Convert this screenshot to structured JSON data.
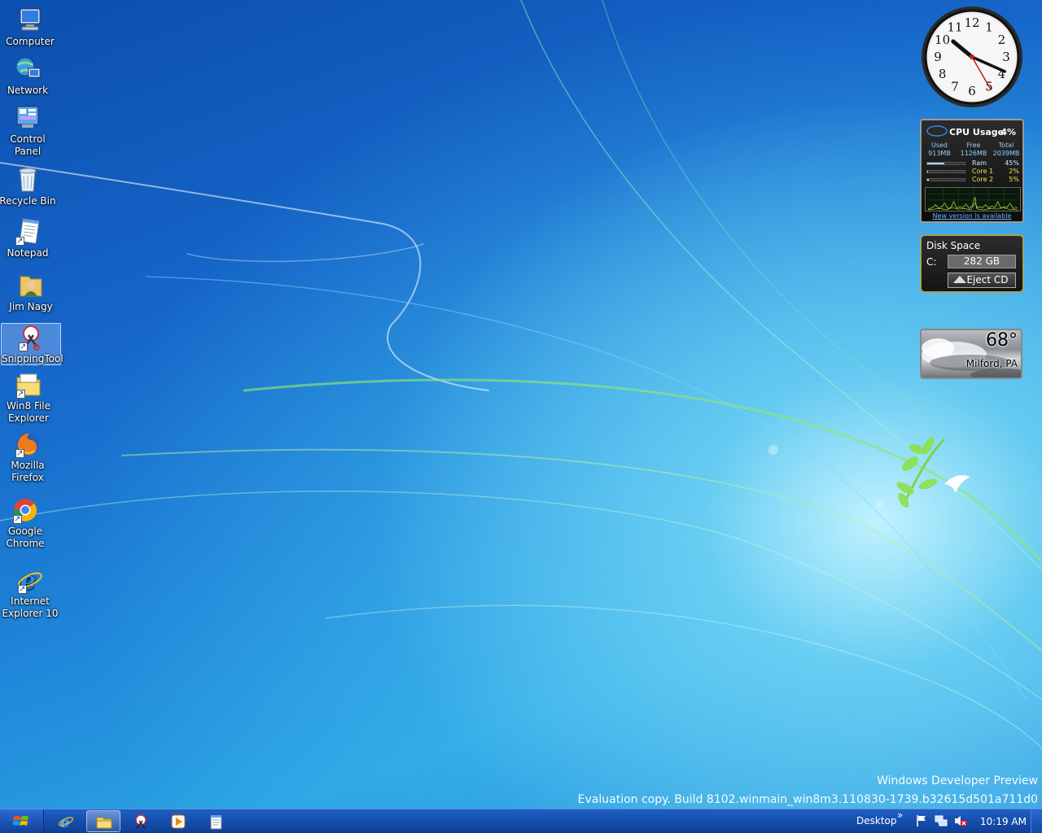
{
  "desktop_icons": [
    {
      "label": "Computer"
    },
    {
      "label": "Network"
    },
    {
      "label": "Control Panel"
    },
    {
      "label": "Recycle Bin"
    },
    {
      "label": "Notepad"
    },
    {
      "label": "Jim Nagy"
    },
    {
      "label": "SnippingTool"
    },
    {
      "label": "Win8 File Explorer"
    },
    {
      "label": "Mozilla Firefox"
    },
    {
      "label": "Google Chrome"
    },
    {
      "label": "Internet Explorer 10"
    }
  ],
  "clock_gadget": {
    "numerals": [
      "12",
      "1",
      "2",
      "3",
      "4",
      "5",
      "6",
      "7",
      "8",
      "9",
      "10",
      "11"
    ],
    "hour": 10,
    "minute": 19,
    "second": 25
  },
  "cpu_gadget": {
    "title": "CPU Usage",
    "percent": "4%",
    "used_label": "Used",
    "used_value": "913MB",
    "free_label": "Free",
    "free_value": "1126MB",
    "total_label": "Total",
    "total_value": "2039MB",
    "rows": [
      {
        "label": "Ram",
        "value": "45%",
        "level": 0.45
      },
      {
        "label": "Core 1",
        "value": "2%",
        "level": 0.02
      },
      {
        "label": "Core 2",
        "value": "5%",
        "level": 0.05
      }
    ],
    "update_link": "New version is available"
  },
  "disk_gadget": {
    "title": "Disk Space",
    "drive": "C:",
    "free": "282 GB",
    "eject_label": "Eject CD"
  },
  "weather_gadget": {
    "temperature": "68°",
    "location": "Milford, PA"
  },
  "watermark": {
    "line1": "Windows Developer Preview",
    "line2": "Evaluation copy. Build 8102.winmain_win8m3.110830-1739.b32615d501a711d0"
  },
  "taskbar": {
    "toolbar_label": "Desktop",
    "chevron": "»",
    "time": "10:19 AM"
  },
  "colors": {
    "taskbar": "#1750b0",
    "accent_green": "#8fe04a"
  }
}
